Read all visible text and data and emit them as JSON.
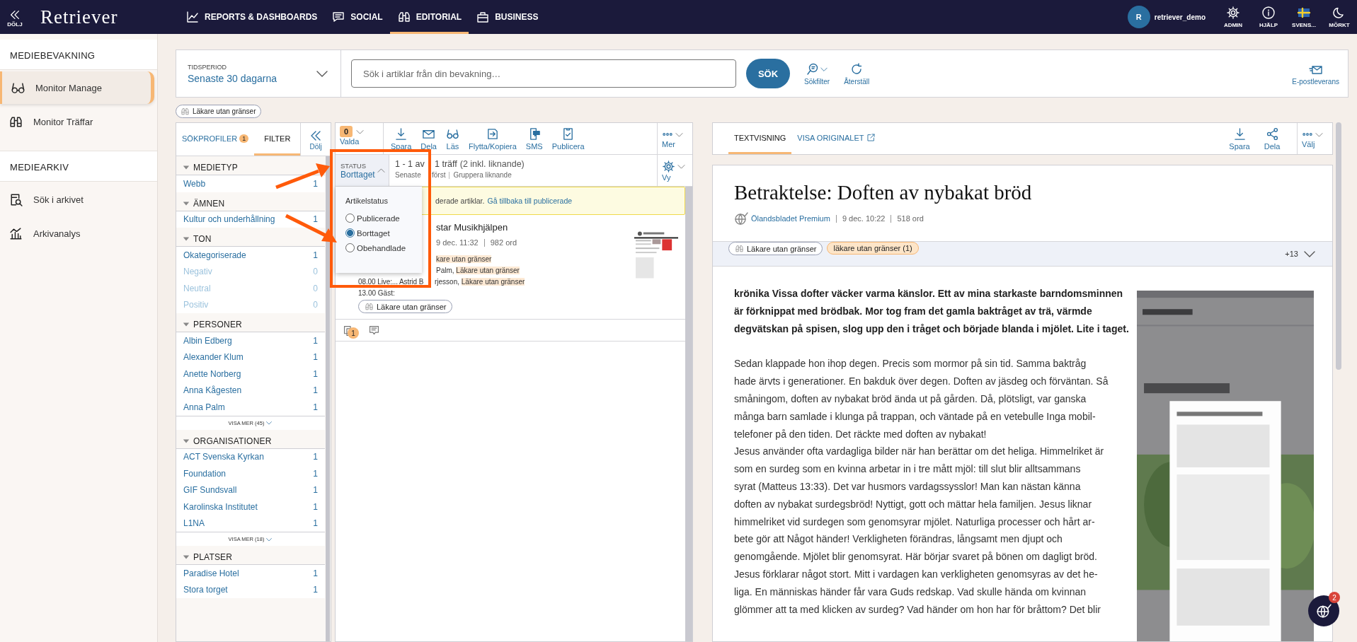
{
  "top_bar": {
    "collapse_label": "DÖLJ",
    "logo": "Retriever",
    "nav": [
      {
        "kind": "chart",
        "label": "REPORTS & DASHBOARDS",
        "selected": false
      },
      {
        "kind": "chat",
        "label": "SOCIAL",
        "selected": false
      },
      {
        "kind": "binoculars",
        "label": "EDITORIAL",
        "selected": true
      },
      {
        "kind": "briefcase",
        "label": "BUSINESS",
        "selected": false
      }
    ],
    "user": {
      "initial": "R",
      "name": "retriever_demo"
    },
    "actions": [
      {
        "kind": "gear",
        "label": "ADMIN"
      },
      {
        "kind": "info",
        "label": "HJÄLP"
      },
      {
        "kind": "flag",
        "label": "SVENS..."
      },
      {
        "kind": "moon",
        "label": "MÖRKT"
      }
    ]
  },
  "sidebar": {
    "sections": [
      {
        "title": "MEDIEBEVAKNING",
        "items": [
          {
            "kind": "glasses",
            "label": "Monitor Manage",
            "selected": true
          },
          {
            "kind": "binoculars",
            "label": "Monitor Träffar",
            "selected": false
          }
        ]
      },
      {
        "title": "MEDIEARKIV",
        "items": [
          {
            "kind": "archive",
            "label": "Sök i arkivet",
            "selected": false
          },
          {
            "kind": "analysis",
            "label": "Arkivanalys",
            "selected": false
          }
        ]
      }
    ]
  },
  "search_bar": {
    "period_label": "TIDSPERIOD",
    "period_value": "Senaste 30 dagarna",
    "placeholder": "Sök i artiklar från din bevakning…",
    "search_button": "SÖK",
    "tools": [
      {
        "kind": "filter",
        "label": "Sökfilter"
      },
      {
        "kind": "reset",
        "label": "Återställ"
      }
    ],
    "delivery": "E-postleverans"
  },
  "profile_chip": "Läkare utan gränser",
  "filter_panel": {
    "tabs": [
      {
        "label": "SÖKPROFILER",
        "badge": "1",
        "selected": false
      },
      {
        "label": "FILTER",
        "selected": true
      }
    ],
    "hide_label": "Dölj",
    "groups": [
      {
        "title": "MEDIETYP",
        "items": [
          {
            "label": "Webb",
            "count": "1",
            "disabled": false
          }
        ]
      },
      {
        "title": "ÄMNEN",
        "items": [
          {
            "label": "Kultur och underhållning",
            "count": "1",
            "disabled": false
          }
        ]
      },
      {
        "title": "TON",
        "items": [
          {
            "label": "Okategoriserade",
            "count": "1",
            "disabled": false
          },
          {
            "label": "Negativ",
            "count": "0",
            "disabled": true
          },
          {
            "label": "Neutral",
            "count": "0",
            "disabled": true
          },
          {
            "label": "Positiv",
            "count": "0",
            "disabled": true
          }
        ]
      },
      {
        "title": "PERSONER",
        "items": [
          {
            "label": "Albin Edberg",
            "count": "1",
            "disabled": false
          },
          {
            "label": "Alexander Klum",
            "count": "1",
            "disabled": false
          },
          {
            "label": "Anette Norberg",
            "count": "1",
            "disabled": false
          },
          {
            "label": "Anna Kågesten",
            "count": "1",
            "disabled": false
          },
          {
            "label": "Anna Palm",
            "count": "1",
            "disabled": false
          }
        ],
        "more": "VISA MER (45)"
      },
      {
        "title": "ORGANISATIONER",
        "items": [
          {
            "label": "ACT Svenska Kyrkan",
            "count": "1",
            "disabled": false
          },
          {
            "label": "Foundation",
            "count": "1",
            "disabled": false
          },
          {
            "label": "GIF Sundsvall",
            "count": "1",
            "disabled": false
          },
          {
            "label": "Karolinska Institutet",
            "count": "1",
            "disabled": false
          },
          {
            "label": "L1NA",
            "count": "1",
            "disabled": false
          }
        ],
        "more": "VISA MER (18)"
      },
      {
        "title": "PLATSER",
        "items": [
          {
            "label": "Paradise Hotel",
            "count": "1",
            "disabled": false
          },
          {
            "label": "Stora torget",
            "count": "1",
            "disabled": false
          }
        ]
      }
    ]
  },
  "article_list": {
    "selected_count": "0",
    "selected_label": "Valda",
    "actions": [
      {
        "kind": "download",
        "label": "Spara"
      },
      {
        "kind": "mail",
        "label": "Dela"
      },
      {
        "kind": "glasses",
        "label": "Läs"
      },
      {
        "kind": "move",
        "label": "Flytta/Kopiera"
      },
      {
        "kind": "phone",
        "label": "SMS"
      },
      {
        "kind": "publish",
        "label": "Publicera"
      }
    ],
    "more_label": "Mer",
    "status_label": "STATUS",
    "status_value": "Borttaget",
    "hits_start": "1 - 1 av",
    "hits_end": "1 träff",
    "hits_similar": "(2 inkl. liknande)",
    "sort_start": "Senaste",
    "sort_end": "först",
    "group": "Gruppera liknande",
    "view_label": "Vy",
    "notice": {
      "text": "derade artiklar.",
      "link": "Gå tillbaka till publicerade"
    },
    "articles": [
      {
        "title": "star Musikhjälpen",
        "date": "9 dec. 11:32",
        "words": "982 ord",
        "snippets": [
          {
            "behind_menu": true,
            "parts": [
              {
                "text": "kare utan gränser",
                "highlight": true
              }
            ]
          },
          {
            "behind_menu": true,
            "parts": [
              {
                "text": "Palm, ",
                "highlight": false
              },
              {
                "text": "Läkare utan gränser",
                "highlight": true
              }
            ]
          },
          {
            "parts": [
              {
                "text": "08.00 Live:... Astrid B",
                "highlight": false
              },
              {
                "text": "rjesson, ",
                "highlight": false
              },
              {
                "text": "Läkare utan gränser",
                "highlight": true
              }
            ]
          },
          {
            "parts": [
              {
                "text": "13.00 Gäst:",
                "highlight": false
              }
            ]
          }
        ],
        "tag": "Läkare utan gränser",
        "similar_count": "1"
      }
    ],
    "status_menu": {
      "title": "Artikelstatus",
      "options": [
        {
          "label": "Publicerade",
          "selected": false
        },
        {
          "label": "Borttaget",
          "selected": true
        },
        {
          "label": "Obehandlade",
          "selected": false
        }
      ]
    }
  },
  "article_view": {
    "tabs": [
      {
        "label": "TEXTVISNING",
        "selected": true,
        "external": false
      },
      {
        "label": "VISA ORIGINALET",
        "selected": false,
        "external": true
      }
    ],
    "actions": [
      {
        "kind": "download",
        "label": "Spara"
      },
      {
        "kind": "share",
        "label": "Dela"
      }
    ],
    "choose_label": "Välj",
    "title": "Betraktelse: Doften av nybakat bröd",
    "source": "Ölandsbladet Premium",
    "date": "9 dec. 10:22",
    "words": "518 ord",
    "tags": [
      {
        "kind": "profile",
        "label": "Läkare utan gränser"
      },
      {
        "kind": "keyword",
        "label": "läkare utan gränser (1)"
      }
    ],
    "more_tags": "+13",
    "lead_lines": [
      "krönika Vissa dofter väcker varma känslor. Ett av mina starkaste barndomsminnen",
      "är förknippat med brödbak. Mor tog fram det gamla baktråget av trä, värmde",
      "degvätskan på spisen, slog upp den i tråget och började blanda i mjölet. Lite i taget."
    ],
    "body_lines": [
      "Sedan klappade hon ihop degen. Precis som mormor på sin tid. Samma baktråg",
      "hade ärvts i generationer. En bakduk över degen. Doften av jäsdeg och förväntan. Så",
      "småningom, doften av nybakat bröd ända ut på gården. Då, plötsligt, var ganska",
      "många barn samlade i klunga på trappan, och väntade på en vetebulle Inga mobil-",
      "telefoner på den tiden. Det räckte med doften av nybakat!",
      "Jesus använder ofta vardagliga bilder när han berättar om det heliga. Himmelriket är",
      "som en surdeg som en kvinna arbetar in i tre mått mjöl: till slut blir alltsammans",
      "syrat (Matteus 13:33). Det var husmors vardagssysslor! Man kan nästan känna",
      "doften av nybakat surdegsbröd! Nyttigt, gott och mättar hela familjen. Jesus liknar",
      "himmelriket vid surdegen som genomsyrar mjölet. Naturliga processer och hårt ar-",
      "bete gör att Något händer! Verkligheten förändras, långsamt men djupt och",
      "genomgående. Mjölet blir genomsyrat. Här börjar svaret på bönen om dagligt bröd.",
      "Jesus förklarar något stort. Mitt i vardagen kan verkligheten genomsyras av det he-",
      "liga. En människas händer får vara Guds redskap. Vad skulle hända om kvinnan",
      "glömmer att ta med klicken av surdeg? Vad händer om hon har för bråttom? Det blir"
    ],
    "image": {
      "kind": "picture"
    }
  },
  "chat_widget": {
    "badge": "2"
  },
  "annotations": [
    {
      "kind": "box"
    },
    {
      "kind": "arrow"
    },
    {
      "kind": "arrow"
    }
  ]
}
